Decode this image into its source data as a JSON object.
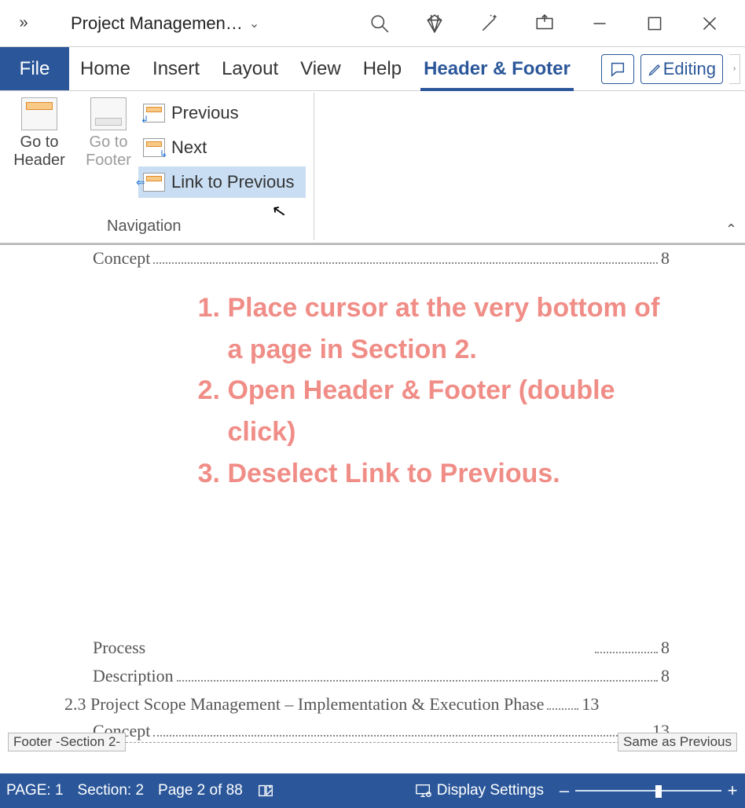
{
  "titlebar": {
    "overflow_icon": "»",
    "doc_title": "Project Managemen…",
    "dropdown_icon": "⌄"
  },
  "window_controls": {
    "minimize": "–",
    "maximize": "□",
    "close": "×"
  },
  "tabs": {
    "file": "File",
    "home": "Home",
    "insert": "Insert",
    "layout": "Layout",
    "view": "View",
    "help": "Help",
    "header_footer": "Header & Footer",
    "editing": "Editing"
  },
  "ribbon": {
    "goto_header_l1": "Go to",
    "goto_header_l2": "Header",
    "goto_footer_l1": "Go to",
    "goto_footer_l2": "Footer",
    "previous": "Previous",
    "next": "Next",
    "link_to_previous": "Link to Previous",
    "group_label": "Navigation",
    "collapse_icon": "⌃"
  },
  "document": {
    "toc": [
      {
        "label": "Concept",
        "page": "8"
      },
      {
        "label": "Process",
        "page": "8"
      },
      {
        "label": "Description",
        "page": "8"
      },
      {
        "label": "2.3 Project Scope Management – Implementation & Execution Phase",
        "page": "13"
      },
      {
        "label": "Concept",
        "page": "13"
      }
    ],
    "annotation": {
      "item1": "Place cursor at the very bottom of a page in Section 2.",
      "item2": "Open Header & Footer (double click)",
      "item3": "Deselect Link to Previous."
    },
    "footer_tag_left": "Footer -Section 2-",
    "footer_tag_right": "Same as Previous"
  },
  "statusbar": {
    "page": "PAGE: 1",
    "section": "Section: 2",
    "page_of": "Page 2 of 88",
    "display_settings": "Display Settings"
  }
}
